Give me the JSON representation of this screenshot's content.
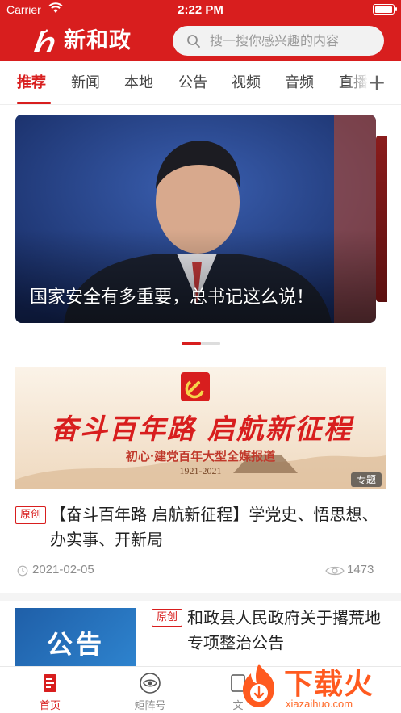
{
  "status_bar": {
    "carrier": "Carrier",
    "time": "2:22 PM",
    "battery_level": 1.0
  },
  "app_bar": {
    "title": "新和政",
    "search_placeholder": "搜一搜你感兴趣的内容"
  },
  "colors": {
    "brand_red": "#d81e1e",
    "header_text": "#ffffff"
  },
  "tabs": [
    {
      "label": "推荐",
      "active": true
    },
    {
      "label": "新闻",
      "active": false
    },
    {
      "label": "本地",
      "active": false
    },
    {
      "label": "公告",
      "active": false
    },
    {
      "label": "视频",
      "active": false
    },
    {
      "label": "音频",
      "active": false
    },
    {
      "label": "直播",
      "active": false
    }
  ],
  "carousel": {
    "caption": "国家安全有多重要，总书记这么说！",
    "current_index": 1,
    "slide_count": 2
  },
  "articles": [
    {
      "banner_headline": "奋斗百年路 启航新征程",
      "banner_subtitle": "初心·建党百年大型全媒报道",
      "banner_years": "1921-2021",
      "topic_badge": "专题",
      "source_badge": "原创",
      "title": "【奋斗百年路 启航新征程】学党史、悟思想、办实事、开新局",
      "date": "2021-02-05",
      "views": "1473"
    },
    {
      "thumb_text": "公告",
      "source_badge": "原创",
      "title": "和政县人民政府关于撂荒地专项整治公告"
    }
  ],
  "bottom_nav": [
    {
      "label": "首页",
      "icon": "home-news-icon",
      "active": true
    },
    {
      "label": "矩阵号",
      "icon": "matrix-eye-icon",
      "active": false
    },
    {
      "label": "文",
      "icon": "doc-icon",
      "active": false
    }
  ],
  "watermark": {
    "text": "下载火",
    "domain": "xiazaihuo.com"
  }
}
